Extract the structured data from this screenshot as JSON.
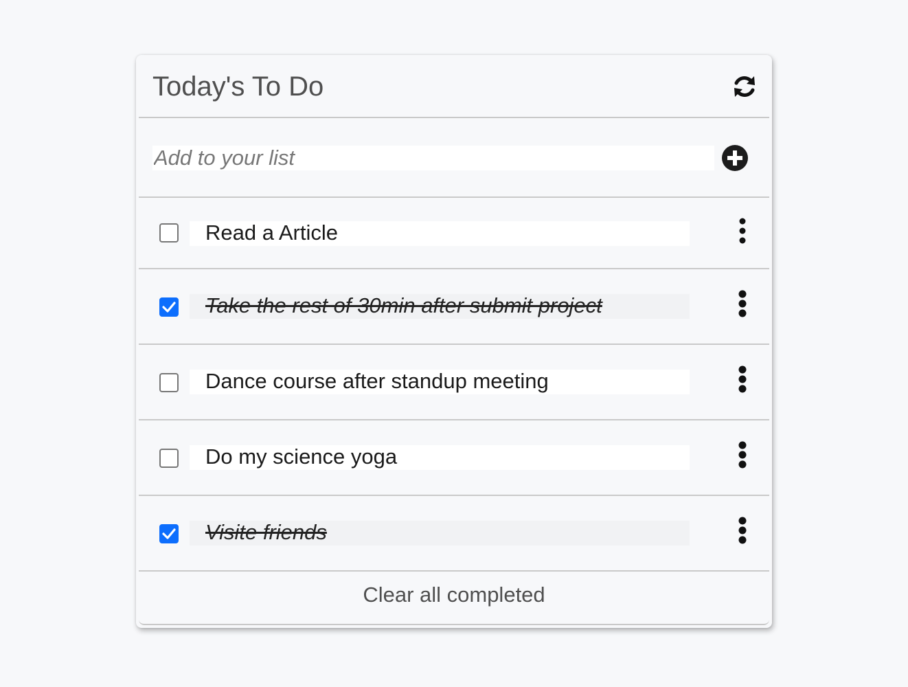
{
  "header": {
    "title": "Today's To Do",
    "refresh_icon": "refresh-icon"
  },
  "add": {
    "placeholder": "Add to your list",
    "value": "",
    "add_icon": "plus-circle-icon"
  },
  "tasks": [
    {
      "text": "Read a Article",
      "completed": false
    },
    {
      "text": "Take the rest of 30min after submit project",
      "completed": true
    },
    {
      "text": "Dance course after standup meeting",
      "completed": false
    },
    {
      "text": "Do my science yoga",
      "completed": false
    },
    {
      "text": "Visite friends",
      "completed": true
    }
  ],
  "footer": {
    "clear_label": "Clear all completed"
  },
  "colors": {
    "checkbox_checked": "#0d6efd",
    "divider": "#c9c9c9",
    "background": "#f7f8fa"
  }
}
